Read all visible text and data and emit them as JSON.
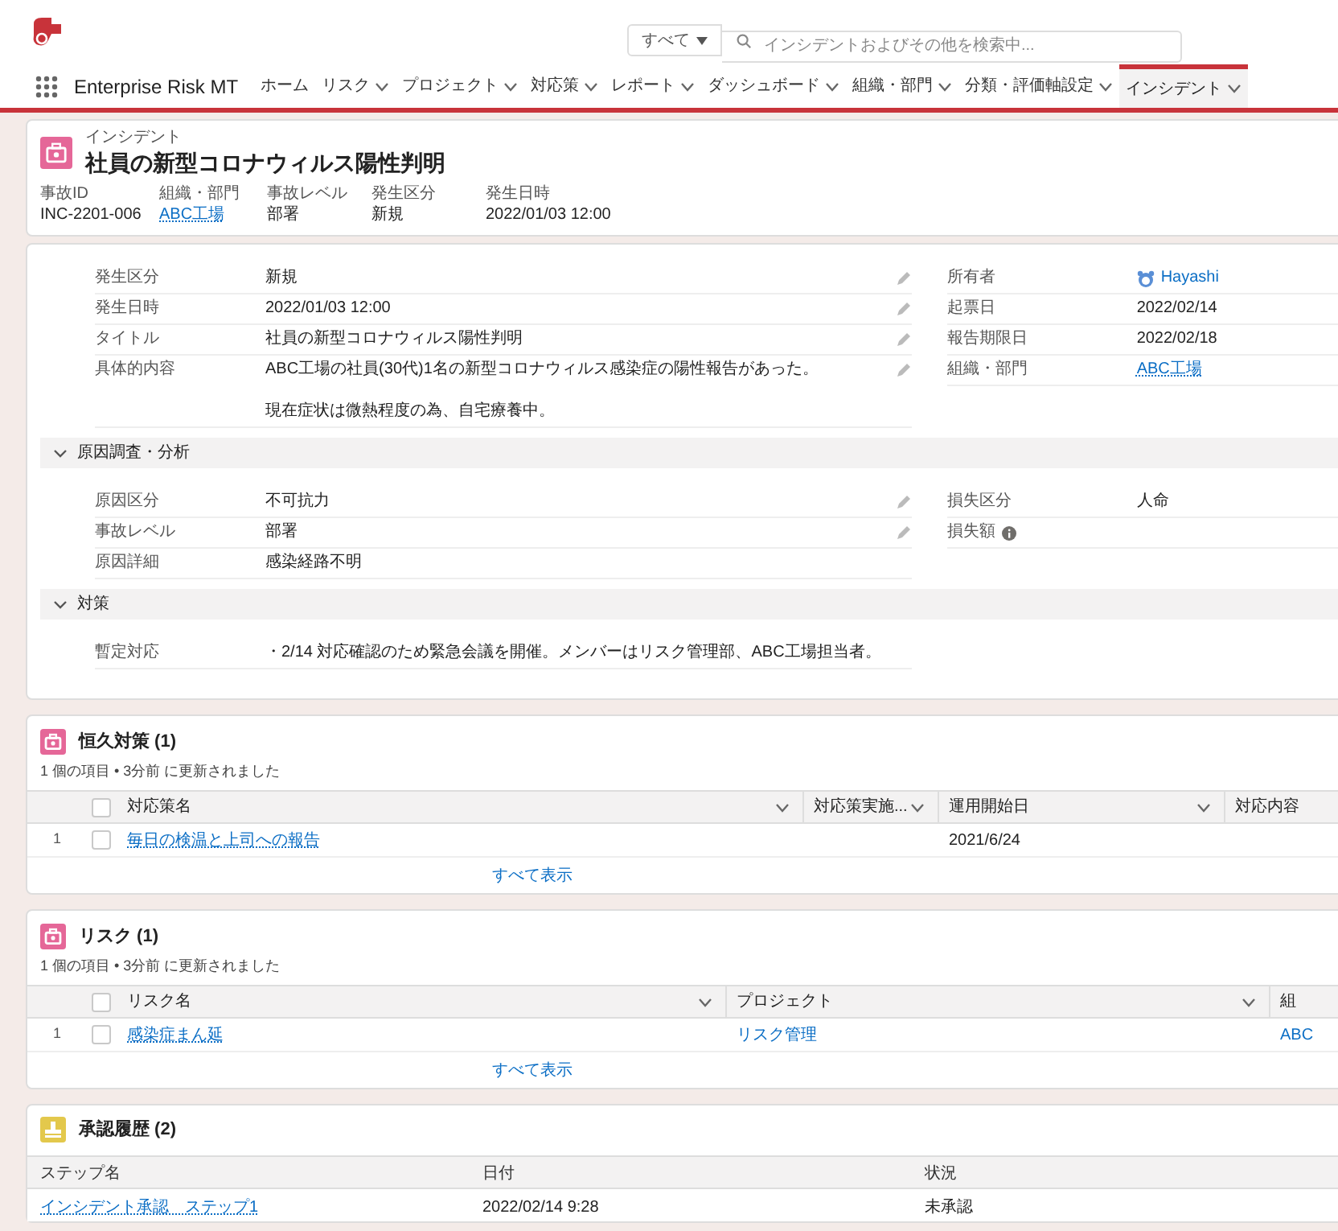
{
  "header": {
    "search": {
      "scope": "すべて",
      "placeholder": "インシデントおよびその他を検索中..."
    }
  },
  "nav": {
    "app_name": "Enterprise Risk MT",
    "tabs": [
      {
        "label": "ホーム",
        "dropdown": false,
        "selected": false
      },
      {
        "label": "リスク",
        "dropdown": true,
        "selected": false
      },
      {
        "label": "プロジェクト",
        "dropdown": true,
        "selected": false
      },
      {
        "label": "対応策",
        "dropdown": true,
        "selected": false
      },
      {
        "label": "レポート",
        "dropdown": true,
        "selected": false
      },
      {
        "label": "ダッシュボード",
        "dropdown": true,
        "selected": false
      },
      {
        "label": "組織・部門",
        "dropdown": true,
        "selected": false
      },
      {
        "label": "分類・評価軸設定",
        "dropdown": true,
        "selected": false
      },
      {
        "label": "インシデント",
        "dropdown": true,
        "selected": true
      }
    ]
  },
  "record": {
    "object": "インシデント",
    "title": "社員の新型コロナウィルス陽性判明",
    "highlights": [
      {
        "label": "事故ID",
        "value": "INC-2201-006",
        "kind": "text"
      },
      {
        "label": "組織・部門",
        "value": "ABC工場",
        "kind": "link"
      },
      {
        "label": "事故レベル",
        "value": "部署",
        "kind": "text"
      },
      {
        "label": "発生区分",
        "value": "新規",
        "kind": "text"
      },
      {
        "label": "発生日時",
        "value": "2022/01/03 12:00",
        "kind": "text"
      }
    ]
  },
  "details": {
    "rows": [
      {
        "left": {
          "label": "発生区分",
          "lines": [
            "新規"
          ],
          "editable": true
        },
        "right": {
          "label": "所有者",
          "value": "Hayashi",
          "kind": "user"
        }
      },
      {
        "left": {
          "label": "発生日時",
          "lines": [
            "2022/01/03 12:00"
          ],
          "editable": true
        },
        "right": {
          "label": "起票日",
          "value": "2022/02/14",
          "kind": "text"
        }
      },
      {
        "left": {
          "label": "タイトル",
          "lines": [
            "社員の新型コロナウィルス陽性判明"
          ],
          "editable": true
        },
        "right": {
          "label": "報告期限日",
          "value": "2022/02/18",
          "kind": "text"
        }
      },
      {
        "left": {
          "label": "具体的内容",
          "lines": [
            "ABC工場の社員(30代)1名の新型コロナウィルス感染症の陽性報告があった。",
            "現在症状は微熱程度の為、自宅療養中。"
          ],
          "editable": true
        },
        "right": {
          "label": "組織・部門",
          "value": "ABC工場",
          "kind": "link"
        }
      }
    ],
    "sections": [
      {
        "title": "原因調査・分析",
        "expanded": true,
        "rows": [
          {
            "left": {
              "label": "原因区分",
              "lines": [
                "不可抗力"
              ],
              "editable": true
            },
            "right": {
              "label": "損失区分",
              "value": "人命",
              "kind": "text"
            }
          },
          {
            "left": {
              "label": "事故レベル",
              "lines": [
                "部署"
              ],
              "editable": true
            },
            "right": {
              "label": "損失額",
              "kind": "info"
            }
          },
          {
            "left": {
              "label": "原因詳細",
              "lines": [
                "感染経路不明"
              ],
              "editable": false
            }
          }
        ]
      },
      {
        "title": "対策",
        "expanded": true,
        "rows": [
          {
            "left": {
              "label": "暫定対応",
              "lines": [
                "・2/14 対応確認のため緊急会議を開催。メンバーはリスク管理部、ABC工場担当者。"
              ],
              "editable": false
            }
          }
        ]
      }
    ]
  },
  "related": [
    {
      "title": "恒久対策 (1)",
      "subtitle": "1 個の項目 • 3分前 に更新されました",
      "select_all_checked": false,
      "columns": [
        {
          "label": "対応策名",
          "menu": true
        },
        {
          "label": "対応策実施...",
          "menu": true
        },
        {
          "label": "運用開始日",
          "menu": true
        },
        {
          "label": "対応内容",
          "menu": false
        }
      ],
      "rows": [
        {
          "number": "1",
          "checked": false,
          "cells": [
            {
              "value": "毎日の検温と上司への報告",
              "kind": "link"
            },
            null,
            {
              "value": "2021/6/24",
              "kind": "text"
            },
            null
          ]
        }
      ],
      "view_all": "すべて表示"
    },
    {
      "title": "リスク (1)",
      "subtitle": "1 個の項目 • 3分前 に更新されました",
      "select_all_checked": false,
      "columns": [
        {
          "label": "リスク名",
          "menu": true
        },
        {
          "label": "プロジェクト",
          "menu": true
        },
        {
          "label": "組",
          "menu": false
        }
      ],
      "rows": [
        {
          "number": "1",
          "checked": false,
          "cells": [
            {
              "value": "感染症まん延",
              "kind": "link"
            },
            {
              "value": "リスク管理",
              "kind": "link"
            },
            {
              "value": "ABC",
              "kind": "link"
            }
          ]
        }
      ],
      "view_all": "すべて表示"
    }
  ],
  "approvals": {
    "title": "承認履歴 (2)",
    "columns": [
      "ステップ名",
      "日付",
      "状況"
    ],
    "rows": [
      [
        "インシデント承認　ステップ1",
        "2022/02/14 9:28",
        "未承認"
      ]
    ]
  }
}
